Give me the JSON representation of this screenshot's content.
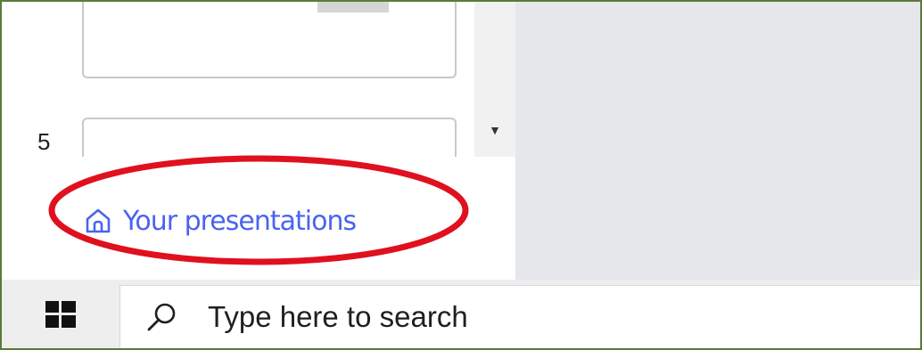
{
  "slide_panel": {
    "slide_number": "5"
  },
  "nav": {
    "your_presentations_label": "Your presentations",
    "icon": "home-icon",
    "link_color": "#4a63f0"
  },
  "annotation": {
    "ellipse_color": "#e0101e"
  },
  "taskbar": {
    "start_icon": "windows-logo-icon",
    "search_icon": "search-icon",
    "search_placeholder": "Type here to search"
  }
}
